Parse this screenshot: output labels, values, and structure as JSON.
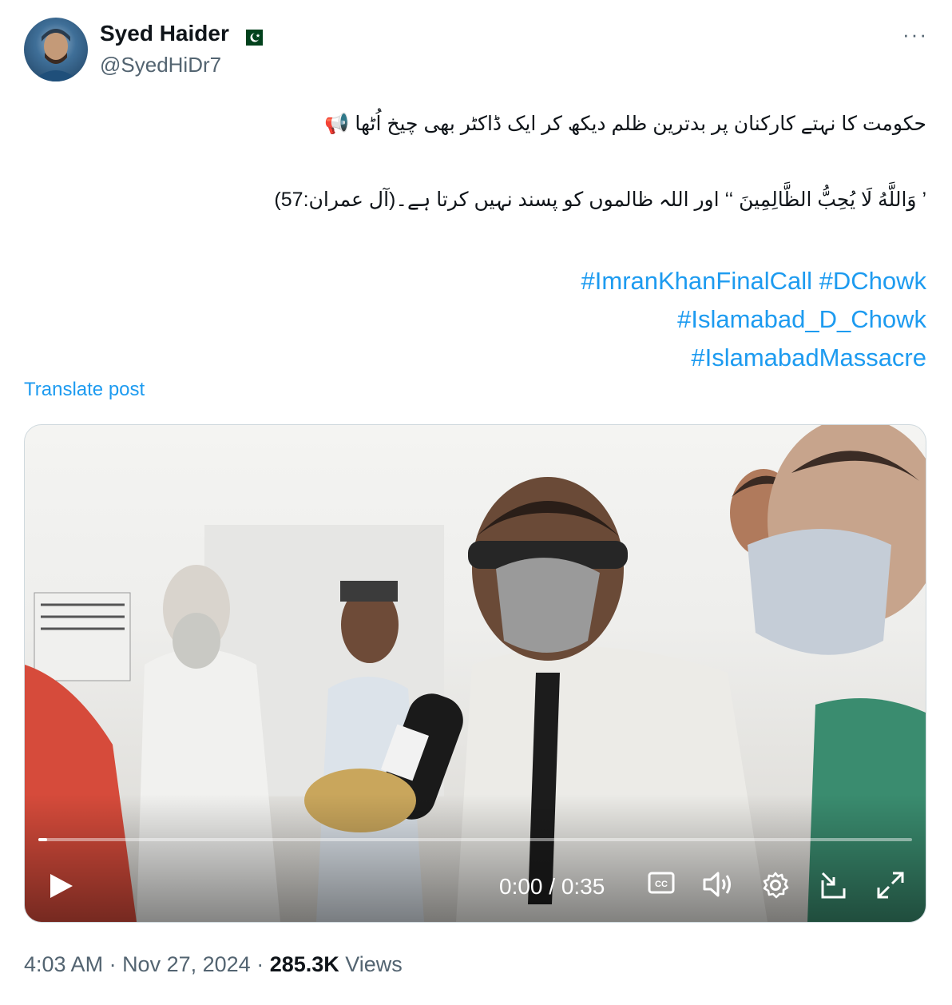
{
  "author": {
    "display_name": "Syed Haider",
    "flag": "pakistan-flag-emoji",
    "handle": "@SyedHiDr7"
  },
  "more_label": "···",
  "post": {
    "line1": "حکومت کا نہتے کارکنان پر بدترین ظلم دیکھ کر ایک ڈاکٹر بھی چیخ اُٹھا 📢",
    "line2": "’ وَاللَّهُ لَا يُحِبُّ الظَّالِمِينَ ‘‘ اور اللہ ظالموں کو پسند نہیں کرتا ہے۔(آل عمران:57)",
    "hashtags": [
      "#ImranKhanFinalCall #DChowk",
      "#Islamabad_D_Chowk",
      "#IslamabadMassacre"
    ],
    "translate_label": "Translate post"
  },
  "video": {
    "time_display": "0:00 / 0:35",
    "progress_fraction": 0.006,
    "controls": [
      "play-icon",
      "cc-icon",
      "volume-icon",
      "settings-icon",
      "dock-icon",
      "fullscreen-icon"
    ]
  },
  "meta": {
    "time": "4:03 AM",
    "separator": " · ",
    "date": "Nov 27, 2024",
    "views_count": "285.3K",
    "views_label": " Views"
  },
  "colors": {
    "link": "#1d9bf0",
    "secondary": "#536471",
    "text": "#0f1419"
  }
}
